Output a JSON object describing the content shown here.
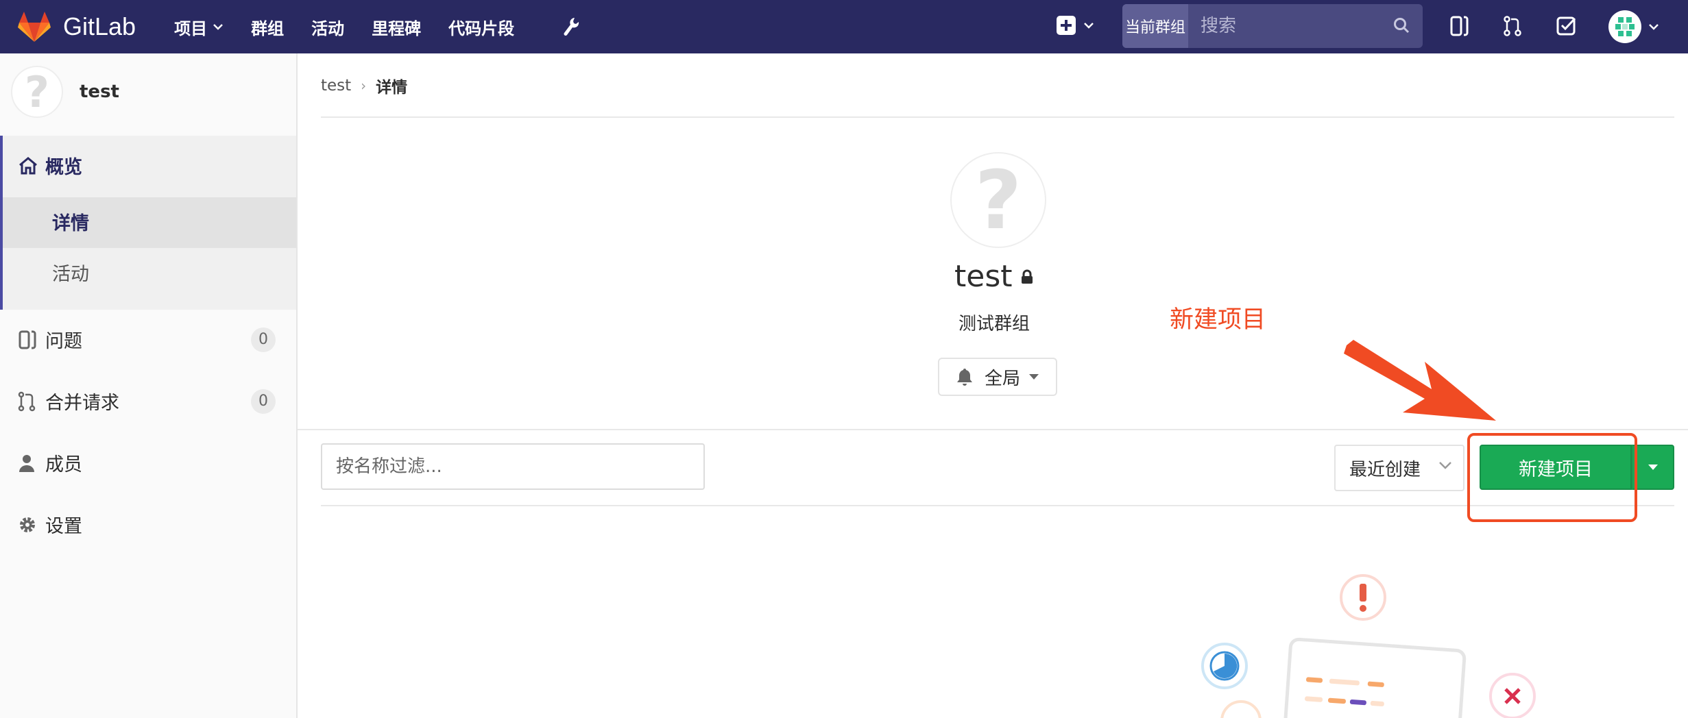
{
  "topbar": {
    "brand": "GitLab",
    "nav": [
      {
        "label": "项目",
        "has_dropdown": true
      },
      {
        "label": "群组"
      },
      {
        "label": "活动"
      },
      {
        "label": "里程碑"
      },
      {
        "label": "代码片段"
      }
    ],
    "search": {
      "scope": "当前群组",
      "placeholder": "搜索"
    },
    "icons": [
      "wrench-icon",
      "plus-square-icon",
      "issues-icon",
      "merge-request-icon",
      "todo-check-icon",
      "user-avatar"
    ]
  },
  "sidebar": {
    "group_name": "test",
    "items": [
      {
        "label": "概览",
        "icon": "home-icon",
        "active": true
      },
      {
        "label": "详情",
        "sub": true,
        "active": true
      },
      {
        "label": "活动",
        "sub": true
      },
      {
        "label": "问题",
        "icon": "issues-icon",
        "count": "0"
      },
      {
        "label": "合并请求",
        "icon": "merge-request-icon",
        "count": "0"
      },
      {
        "label": "成员",
        "icon": "user-icon"
      },
      {
        "label": "设置",
        "icon": "gear-icon"
      }
    ]
  },
  "breadcrumb": {
    "parent": "test",
    "current": "详情"
  },
  "group": {
    "title": "test",
    "description": "测试群组",
    "notification_level": "全局"
  },
  "toolbar": {
    "filter_placeholder": "按名称过滤...",
    "sort_label": "最近创建",
    "new_project_label": "新建项目"
  },
  "annotation": {
    "label": "新建项目",
    "color": "#f04b23"
  },
  "colors": {
    "navbar": "#292961",
    "primary_green": "#1aaa55",
    "sidebar_accent": "#4b4ba3"
  }
}
